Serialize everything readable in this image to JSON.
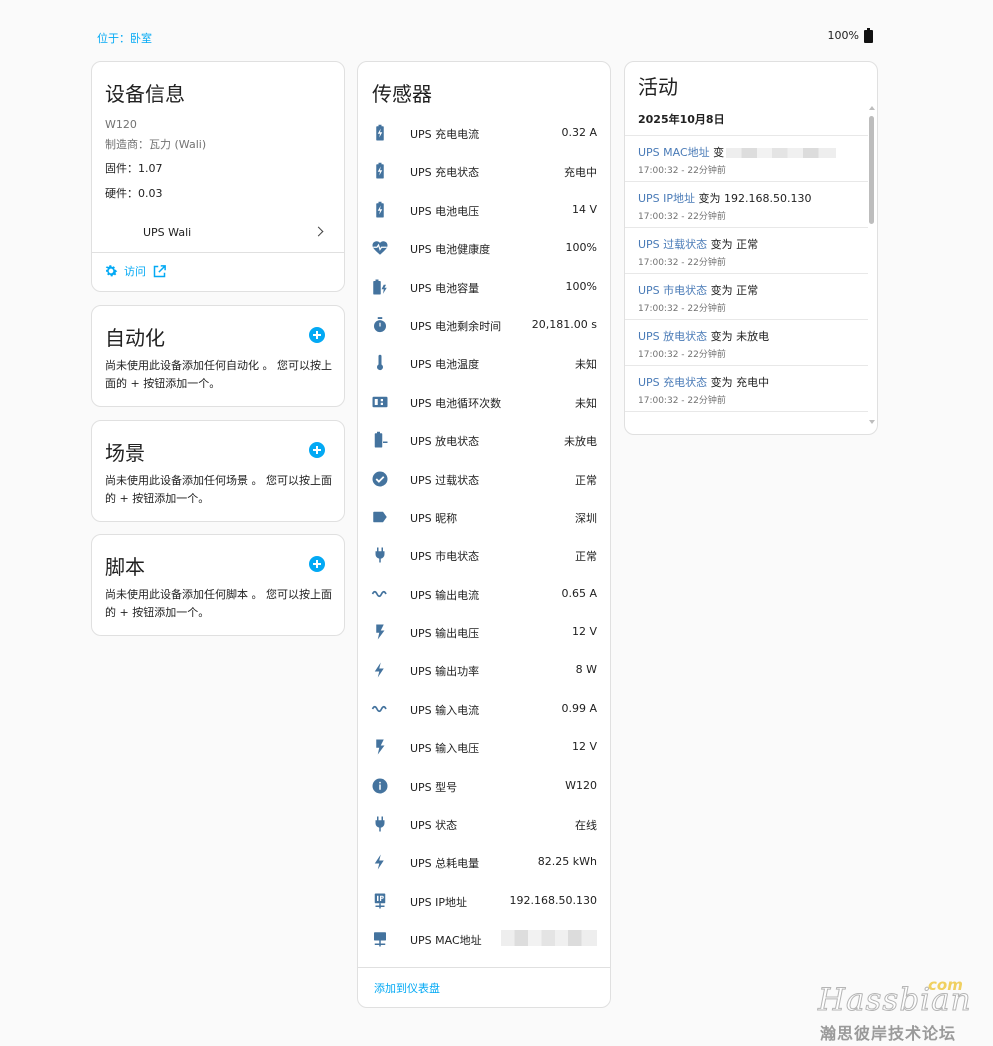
{
  "header": {
    "area": "位于：卧室",
    "battery": "100%"
  },
  "device_info": {
    "title": "设备信息",
    "model": "W120",
    "manufacturer": "制造商：瓦力 (Wali)",
    "firmware": "固件：1.07",
    "hardware": "硬件：0.03",
    "linked_device": "UPS Wali",
    "visit_label": "访问"
  },
  "automation": {
    "title": "自动化",
    "description": "尚未使用此设备添加任何自动化 。 您可以按上面的 + 按钮添加一个。"
  },
  "scene": {
    "title": "场景",
    "description": "尚未使用此设备添加任何场景 。 您可以按上面的 + 按钮添加一个。"
  },
  "script": {
    "title": "脚本",
    "description": "尚未使用此设备添加任何脚本 。 您可以按上面的 + 按钮添加一个。"
  },
  "sensors": {
    "title": "传感器",
    "add_to_dashboard": "添加到仪表盘",
    "icon_color": "#44739e",
    "items": [
      {
        "name": "UPS 充电电流",
        "value": "0.32 A",
        "icon": "battery-charging-icon"
      },
      {
        "name": "UPS 充电状态",
        "value": "充电中",
        "icon": "battery-charging-icon"
      },
      {
        "name": "UPS 电池电压",
        "value": "14 V",
        "icon": "battery-charging-icon"
      },
      {
        "name": "UPS 电池健康度",
        "value": "100%",
        "icon": "heart-pulse-icon"
      },
      {
        "name": "UPS 电池容量",
        "value": "100%",
        "icon": "battery-bolt-icon"
      },
      {
        "name": "UPS 电池剩余时间",
        "value": "20,181.00 s",
        "icon": "timer-icon"
      },
      {
        "name": "UPS 电池温度",
        "value": "未知",
        "icon": "thermometer-icon"
      },
      {
        "name": "UPS 电池循环次数",
        "value": "未知",
        "icon": "counter-icon"
      },
      {
        "name": "UPS 放电状态",
        "value": "未放电",
        "icon": "battery-minus-icon"
      },
      {
        "name": "UPS 过载状态",
        "value": "正常",
        "icon": "check-circle-icon"
      },
      {
        "name": "UPS 昵称",
        "value": "深圳",
        "icon": "label-icon"
      },
      {
        "name": "UPS 市电状态",
        "value": "正常",
        "icon": "power-plug-icon"
      },
      {
        "name": "UPS 输出电流",
        "value": "0.65 A",
        "icon": "current-ac-icon"
      },
      {
        "name": "UPS 输出电压",
        "value": "12 V",
        "icon": "flash-icon"
      },
      {
        "name": "UPS 输出功率",
        "value": "8 W",
        "icon": "lightning-icon"
      },
      {
        "name": "UPS 输入电流",
        "value": "0.99 A",
        "icon": "current-ac-icon"
      },
      {
        "name": "UPS 输入电压",
        "value": "12 V",
        "icon": "flash-icon"
      },
      {
        "name": "UPS 型号",
        "value": "W120",
        "icon": "info-icon"
      },
      {
        "name": "UPS 状态",
        "value": "在线",
        "icon": "power-plug-icon"
      },
      {
        "name": "UPS 总耗电量",
        "value": "82.25 kWh",
        "icon": "lightning-icon"
      },
      {
        "name": "UPS IP地址",
        "value": "192.168.50.130",
        "icon": "ip-network-icon"
      },
      {
        "name": "UPS MAC地址",
        "value": "",
        "icon": "lan-icon"
      }
    ]
  },
  "activity": {
    "title": "活动",
    "date": "2025年10月8日",
    "items": [
      {
        "entity": "UPS MAC地址",
        "text": " 变",
        "time": "17:00:32 - 22分钟前"
      },
      {
        "entity": "UPS IP地址",
        "text": " 变为 192.168.50.130",
        "time": "17:00:32 - 22分钟前"
      },
      {
        "entity": "UPS 过载状态",
        "text": " 变为 正常",
        "time": "17:00:32 - 22分钟前"
      },
      {
        "entity": "UPS 市电状态",
        "text": " 变为 正常",
        "time": "17:00:32 - 22分钟前"
      },
      {
        "entity": "UPS 放电状态",
        "text": " 变为 未放电",
        "time": "17:00:32 - 22分钟前"
      },
      {
        "entity": "UPS 充电状态",
        "text": " 变为 充电中",
        "time": "17:00:32 - 22分钟前"
      }
    ]
  },
  "watermark": {
    "logo": "Hassbian",
    "com": "com",
    "subtitle": "瀚思彼岸技术论坛"
  }
}
